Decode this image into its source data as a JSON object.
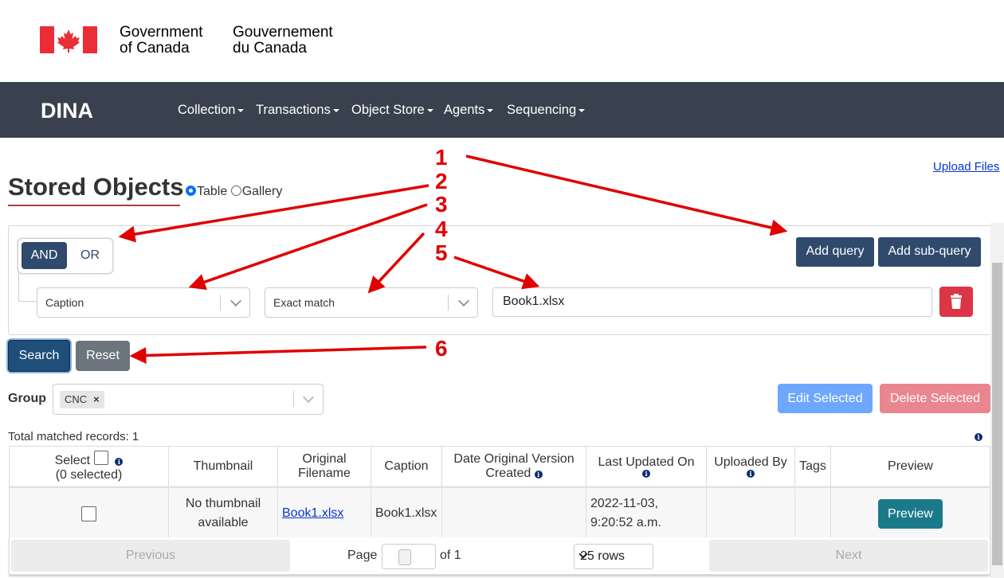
{
  "gov": {
    "en_line1": "Government",
    "en_line2": "of Canada",
    "fr_line1": "Gouvernement",
    "fr_line2": "du Canada"
  },
  "nav": {
    "brand": "DINA",
    "items": [
      "Collection",
      "Transactions",
      "Object Store",
      "Agents",
      "Sequencing"
    ]
  },
  "page": {
    "title": "Stored Objects",
    "upload_link": "Upload Files",
    "view_table": "Table",
    "view_gallery": "Gallery",
    "selected_view": "Table"
  },
  "query": {
    "and_label": "AND",
    "or_label": "OR",
    "field": "Caption",
    "operator": "Exact match",
    "value": "Book1.xlsx",
    "add_query": "Add query",
    "add_subquery": "Add sub-query"
  },
  "actions": {
    "search": "Search",
    "reset": "Reset",
    "edit_selected": "Edit Selected",
    "delete_selected": "Delete Selected"
  },
  "group": {
    "label": "Group",
    "chip": "CNC"
  },
  "results": {
    "total": "Total matched records: 1",
    "headers": {
      "select": "Select",
      "selected_count": "(0 selected)",
      "thumbnail": "Thumbnail",
      "original_filename_1": "Original",
      "original_filename_2": "Filename",
      "caption": "Caption",
      "date_original_1": "Date Original Version",
      "date_original_2": "Created",
      "last_updated": "Last Updated On",
      "uploaded_by": "Uploaded By",
      "tags": "Tags",
      "preview": "Preview"
    },
    "rows": [
      {
        "thumb_1": "No thumbnail",
        "thumb_2": "available",
        "filename": "Book1.xlsx",
        "caption": "Book1.xlsx",
        "date_created": "",
        "last_updated_1": "2022-11-03,",
        "last_updated_2": "9:20:52 a.m.",
        "uploaded_by": "",
        "tags": "",
        "preview": "Preview"
      }
    ]
  },
  "pager": {
    "previous": "Previous",
    "page_label": "Page",
    "page": "1",
    "of": "of 1",
    "rows": "25 rows",
    "next": "Next"
  },
  "annotations": [
    "1",
    "2",
    "3",
    "4",
    "5",
    "6"
  ],
  "colors": {
    "navbar": "#38414d",
    "primary_dark": "#2f4a6c",
    "danger": "#dc3545",
    "annotation": "#e00000",
    "preview": "#1a7a8a"
  }
}
